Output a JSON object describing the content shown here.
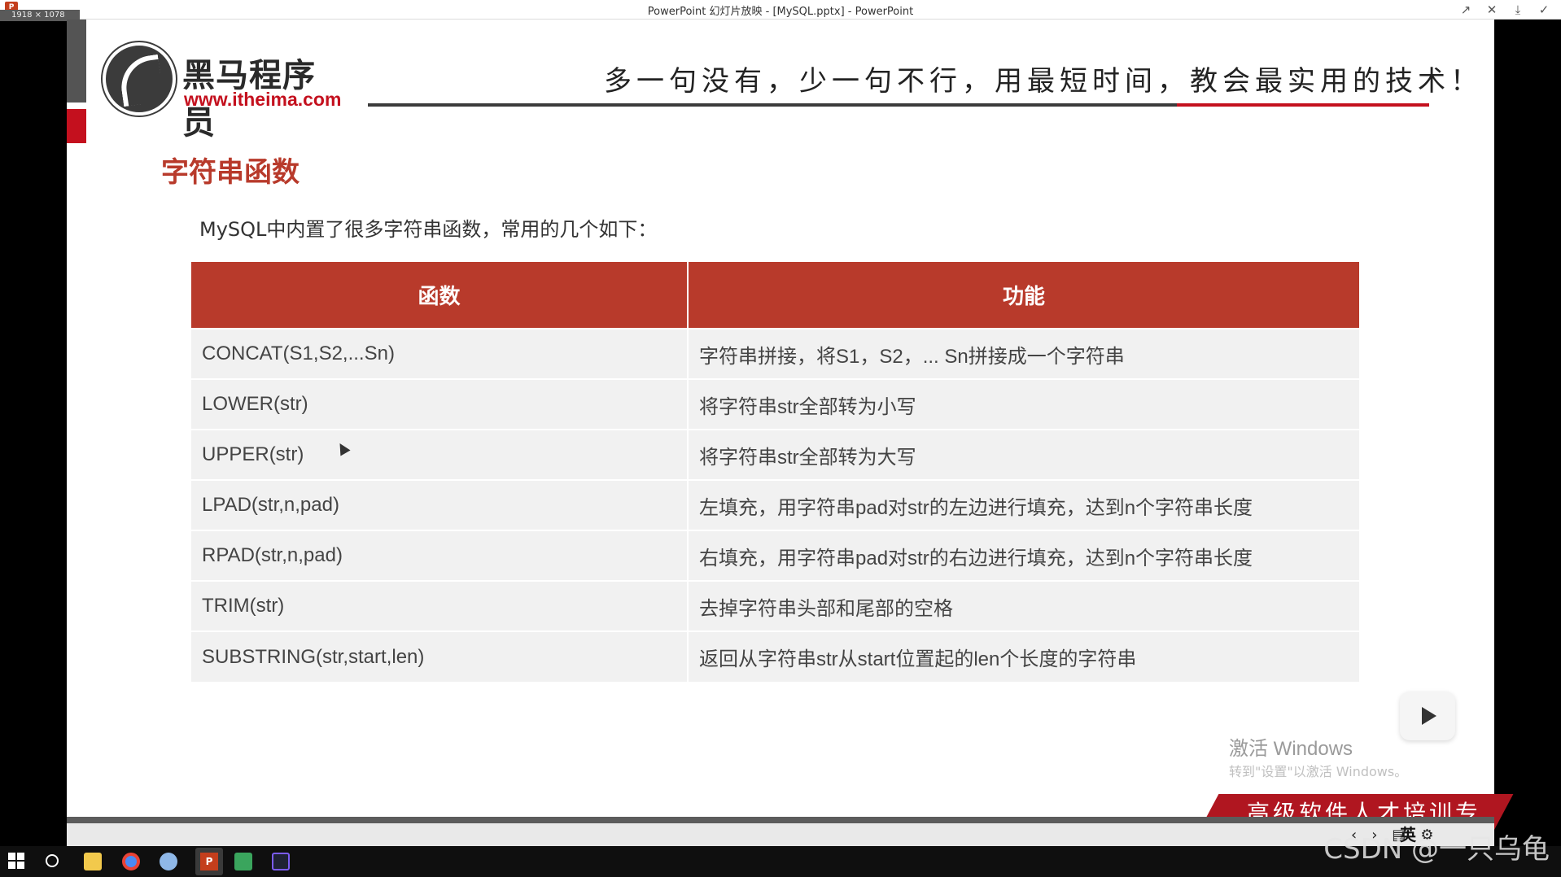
{
  "window": {
    "app_icon_text": "P",
    "size_chip": "1918 × 1078",
    "title": "PowerPoint 幻灯片放映 - [MySQL.pptx] - PowerPoint",
    "controls": [
      "↗",
      "✕",
      "⤓",
      "✓"
    ]
  },
  "slide": {
    "logo_cn": "黑马程序员",
    "logo_url": "www.itheima.com",
    "slogan": "多一句没有，少一句不行，用最短时间，教会最实用的技术！",
    "title": "字符串函数",
    "intro": "MySQL中内置了很多字符串函数，常用的几个如下：",
    "table": {
      "headers": [
        "函数",
        "功能"
      ],
      "rows": [
        [
          "CONCAT(S1,S2,...Sn)",
          "字符串拼接，将S1，S2，... Sn拼接成一个字符串"
        ],
        [
          "LOWER(str)",
          "将字符串str全部转为小写"
        ],
        [
          "UPPER(str)",
          "将字符串str全部转为大写"
        ],
        [
          "LPAD(str,n,pad)",
          "左填充，用字符串pad对str的左边进行填充，达到n个字符串长度"
        ],
        [
          "RPAD(str,n,pad)",
          "右填充，用字符串pad对str的右边进行填充，达到n个字符串长度"
        ],
        [
          "TRIM(str)",
          "去掉字符串头部和尾部的空格"
        ],
        [
          "SUBSTRING(str,start,len)",
          "返回从字符串str从start位置起的len个长度的字符串"
        ]
      ]
    },
    "banner": "高级软件人才培训专家",
    "activate_title": "激活 Windows",
    "activate_sub": "转到\"设置\"以激活 Windows。"
  },
  "slideshow_toolbar": {
    "lang": "英",
    "tools": [
      "‹",
      "›",
      "▤",
      "⚙"
    ]
  },
  "watermark": "CSDN @一只乌龟",
  "colors": {
    "accent_red": "#b83a2b",
    "brand_red": "#c4101e",
    "table_row": "#f1f1f1"
  }
}
